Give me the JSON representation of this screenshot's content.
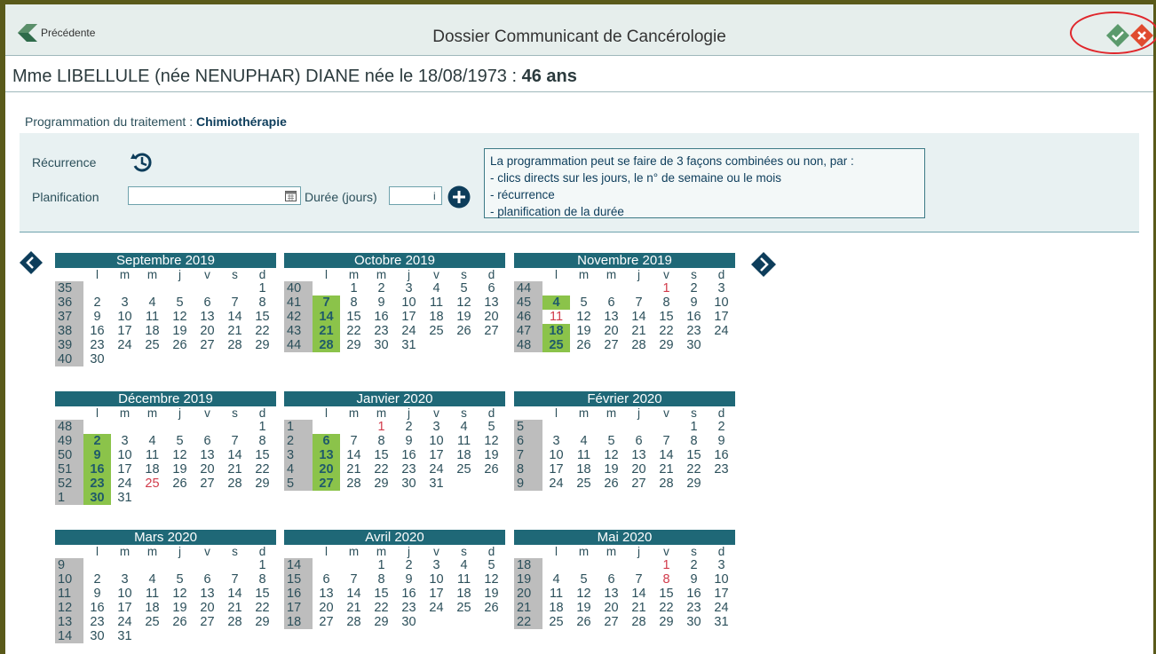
{
  "header": {
    "back_label": "Précédente",
    "title": "Dossier Communicant de Cancérologie",
    "ok_icon": "check-icon",
    "cancel_icon": "close-icon"
  },
  "patient": {
    "name_line": "Mme LIBELLULE (née NENUPHAR) DIANE née le 18/08/1973 : ",
    "age": "46 ans"
  },
  "programming": {
    "label": "Programmation du traitement : ",
    "value": "Chimiothérapie"
  },
  "form": {
    "recurrence_label": "Récurrence",
    "planification_label": "Planification",
    "planification_value": "",
    "duree_label": "Durée (jours)",
    "duree_value": "",
    "duree_suffix": "i"
  },
  "info": {
    "line1": "La programmation peut se faire de 3 façons combinées ou non, par :",
    "line2": "- clics directs sur les jours, le n° de semaine ou le mois",
    "line3": "- récurrence",
    "line4": "- planification de la durée"
  },
  "weekday_labels": [
    "l",
    "m",
    "m",
    "j",
    "v",
    "s",
    "d"
  ],
  "months": [
    {
      "title": "Septembre 2019",
      "weeks": [
        {
          "wk": "35",
          "days": [
            "",
            "",
            "",
            "",
            "",
            "",
            "1"
          ]
        },
        {
          "wk": "36",
          "days": [
            "2",
            "3",
            "4",
            "5",
            "6",
            "7",
            "8"
          ]
        },
        {
          "wk": "37",
          "days": [
            "9",
            "10",
            "11",
            "12",
            "13",
            "14",
            "15"
          ]
        },
        {
          "wk": "38",
          "days": [
            "16",
            "17",
            "18",
            "19",
            "20",
            "21",
            "22"
          ]
        },
        {
          "wk": "39",
          "days": [
            "23",
            "24",
            "25",
            "26",
            "27",
            "28",
            "29"
          ]
        },
        {
          "wk": "40",
          "days": [
            "30",
            "",
            "",
            "",
            "",
            "",
            ""
          ]
        }
      ],
      "selected": [],
      "holidays": []
    },
    {
      "title": "Octobre 2019",
      "weeks": [
        {
          "wk": "40",
          "days": [
            "",
            "1",
            "2",
            "3",
            "4",
            "5",
            "6"
          ]
        },
        {
          "wk": "41",
          "days": [
            "7",
            "8",
            "9",
            "10",
            "11",
            "12",
            "13"
          ]
        },
        {
          "wk": "42",
          "days": [
            "14",
            "15",
            "16",
            "17",
            "18",
            "19",
            "20"
          ]
        },
        {
          "wk": "43",
          "days": [
            "21",
            "22",
            "23",
            "24",
            "25",
            "26",
            "27"
          ]
        },
        {
          "wk": "44",
          "days": [
            "28",
            "29",
            "30",
            "31",
            "",
            "",
            ""
          ]
        }
      ],
      "selected": [
        "7",
        "14",
        "21",
        "28"
      ],
      "holidays": []
    },
    {
      "title": "Novembre 2019",
      "weeks": [
        {
          "wk": "44",
          "days": [
            "",
            "",
            "",
            "",
            "1",
            "2",
            "3"
          ]
        },
        {
          "wk": "45",
          "days": [
            "4",
            "5",
            "6",
            "7",
            "8",
            "9",
            "10"
          ]
        },
        {
          "wk": "46",
          "days": [
            "11",
            "12",
            "13",
            "14",
            "15",
            "16",
            "17"
          ]
        },
        {
          "wk": "47",
          "days": [
            "18",
            "19",
            "20",
            "21",
            "22",
            "23",
            "24"
          ]
        },
        {
          "wk": "48",
          "days": [
            "25",
            "26",
            "27",
            "28",
            "29",
            "30",
            ""
          ]
        }
      ],
      "selected": [
        "4",
        "18",
        "25"
      ],
      "holidays": [
        "1",
        "11"
      ]
    },
    {
      "title": "Décembre 2019",
      "weeks": [
        {
          "wk": "48",
          "days": [
            "",
            "",
            "",
            "",
            "",
            "",
            "1"
          ]
        },
        {
          "wk": "49",
          "days": [
            "2",
            "3",
            "4",
            "5",
            "6",
            "7",
            "8"
          ]
        },
        {
          "wk": "50",
          "days": [
            "9",
            "10",
            "11",
            "12",
            "13",
            "14",
            "15"
          ]
        },
        {
          "wk": "51",
          "days": [
            "16",
            "17",
            "18",
            "19",
            "20",
            "21",
            "22"
          ]
        },
        {
          "wk": "52",
          "days": [
            "23",
            "24",
            "25",
            "26",
            "27",
            "28",
            "29"
          ]
        },
        {
          "wk": "1",
          "days": [
            "30",
            "31",
            "",
            "",
            "",
            "",
            ""
          ]
        }
      ],
      "selected": [
        "2",
        "9",
        "16",
        "23",
        "30"
      ],
      "holidays": [
        "25"
      ]
    },
    {
      "title": "Janvier 2020",
      "weeks": [
        {
          "wk": "1",
          "days": [
            "",
            "",
            "1",
            "2",
            "3",
            "4",
            "5"
          ]
        },
        {
          "wk": "2",
          "days": [
            "6",
            "7",
            "8",
            "9",
            "10",
            "11",
            "12"
          ]
        },
        {
          "wk": "3",
          "days": [
            "13",
            "14",
            "15",
            "16",
            "17",
            "18",
            "19"
          ]
        },
        {
          "wk": "4",
          "days": [
            "20",
            "21",
            "22",
            "23",
            "24",
            "25",
            "26"
          ]
        },
        {
          "wk": "5",
          "days": [
            "27",
            "28",
            "29",
            "30",
            "31",
            "",
            ""
          ]
        }
      ],
      "selected": [
        "6",
        "13",
        "20",
        "27"
      ],
      "holidays": [
        "1"
      ]
    },
    {
      "title": "Février 2020",
      "weeks": [
        {
          "wk": "5",
          "days": [
            "",
            "",
            "",
            "",
            "",
            "1",
            "2"
          ]
        },
        {
          "wk": "6",
          "days": [
            "3",
            "4",
            "5",
            "6",
            "7",
            "8",
            "9"
          ]
        },
        {
          "wk": "7",
          "days": [
            "10",
            "11",
            "12",
            "13",
            "14",
            "15",
            "16"
          ]
        },
        {
          "wk": "8",
          "days": [
            "17",
            "18",
            "19",
            "20",
            "21",
            "22",
            "23"
          ]
        },
        {
          "wk": "9",
          "days": [
            "24",
            "25",
            "26",
            "27",
            "28",
            "29",
            ""
          ]
        }
      ],
      "selected": [],
      "holidays": []
    },
    {
      "title": "Mars 2020",
      "weeks": [
        {
          "wk": "9",
          "days": [
            "",
            "",
            "",
            "",
            "",
            "",
            "1"
          ]
        },
        {
          "wk": "10",
          "days": [
            "2",
            "3",
            "4",
            "5",
            "6",
            "7",
            "8"
          ]
        },
        {
          "wk": "11",
          "days": [
            "9",
            "10",
            "11",
            "12",
            "13",
            "14",
            "15"
          ]
        },
        {
          "wk": "12",
          "days": [
            "16",
            "17",
            "18",
            "19",
            "20",
            "21",
            "22"
          ]
        },
        {
          "wk": "13",
          "days": [
            "23",
            "24",
            "25",
            "26",
            "27",
            "28",
            "29"
          ]
        },
        {
          "wk": "14",
          "days": [
            "30",
            "31",
            "",
            "",
            "",
            "",
            ""
          ]
        }
      ],
      "selected": [],
      "holidays": []
    },
    {
      "title": "Avril 2020",
      "weeks": [
        {
          "wk": "14",
          "days": [
            "",
            "",
            "1",
            "2",
            "3",
            "4",
            "5"
          ]
        },
        {
          "wk": "15",
          "days": [
            "6",
            "7",
            "8",
            "9",
            "10",
            "11",
            "12"
          ]
        },
        {
          "wk": "16",
          "days": [
            "13",
            "14",
            "15",
            "16",
            "17",
            "18",
            "19"
          ]
        },
        {
          "wk": "17",
          "days": [
            "20",
            "21",
            "22",
            "23",
            "24",
            "25",
            "26"
          ]
        },
        {
          "wk": "18",
          "days": [
            "27",
            "28",
            "29",
            "30",
            "",
            "",
            ""
          ]
        }
      ],
      "selected": [],
      "holidays": []
    },
    {
      "title": "Mai 2020",
      "weeks": [
        {
          "wk": "18",
          "days": [
            "",
            "",
            "",
            "",
            "1",
            "2",
            "3"
          ]
        },
        {
          "wk": "19",
          "days": [
            "4",
            "5",
            "6",
            "7",
            "8",
            "9",
            "10"
          ]
        },
        {
          "wk": "20",
          "days": [
            "11",
            "12",
            "13",
            "14",
            "15",
            "16",
            "17"
          ]
        },
        {
          "wk": "21",
          "days": [
            "18",
            "19",
            "20",
            "21",
            "22",
            "23",
            "24"
          ]
        },
        {
          "wk": "22",
          "days": [
            "25",
            "26",
            "27",
            "28",
            "29",
            "30",
            "31"
          ]
        }
      ],
      "selected": [],
      "holidays": [
        "1",
        "8"
      ]
    }
  ],
  "colors": {
    "header_bg": "#1f6877",
    "selected_bg": "#8bc34a",
    "holiday": "#d13a4a",
    "week_bg": "#bdbdbd",
    "annotation_ellipse": "#e0262b"
  }
}
